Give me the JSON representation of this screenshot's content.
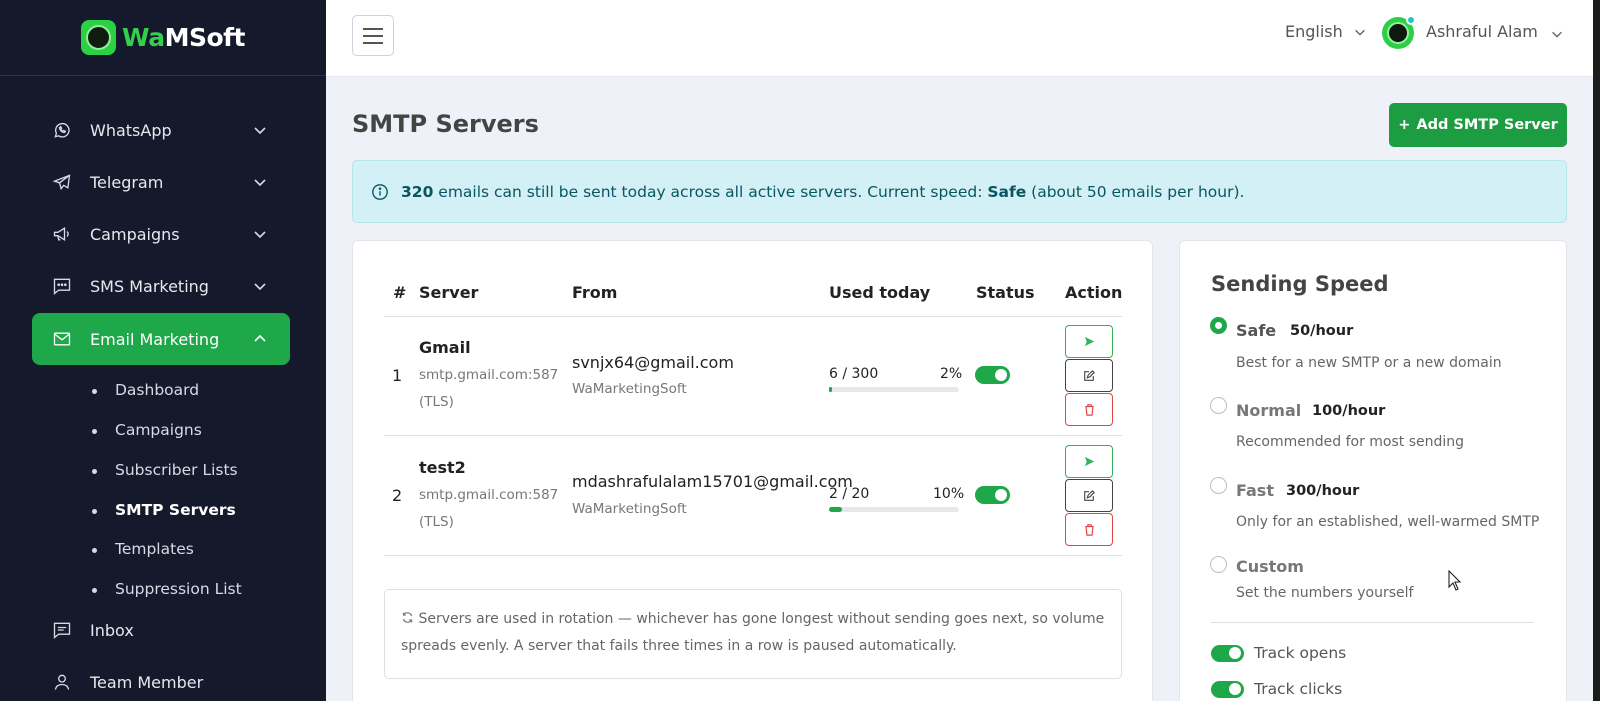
{
  "brand": {
    "name_part1": "Wa",
    "name_part2": "MSoft"
  },
  "sidebar": {
    "items": [
      {
        "label": "WhatsApp"
      },
      {
        "label": "Telegram"
      },
      {
        "label": "Campaigns"
      },
      {
        "label": "SMS Marketing"
      },
      {
        "label": "Email Marketing"
      },
      {
        "label": "Inbox"
      },
      {
        "label": "Team Member"
      }
    ],
    "email_sub": [
      "Dashboard",
      "Campaigns",
      "Subscriber Lists",
      "SMTP Servers",
      "Templates",
      "Suppression List"
    ]
  },
  "topbar": {
    "language": "English",
    "user_name": "Ashraful Alam"
  },
  "page": {
    "title": "SMTP Servers",
    "add_button": "Add SMTP Server"
  },
  "alert": {
    "count": "320",
    "text1": " emails can still be sent today across all active servers. Current speed: ",
    "speed": "Safe",
    "text2": " (about 50 emails per hour)."
  },
  "table": {
    "headers": [
      "#",
      "Server",
      "From",
      "Used today",
      "Status",
      "Action"
    ],
    "rows": [
      {
        "num": "1",
        "name": "Gmail",
        "host": "smtp.gmail.com:587",
        "security": "(TLS)",
        "from_email": "svnjx64@gmail.com",
        "from_name": "WaMarketingSoft",
        "usage": "6 / 300",
        "pct": "2%",
        "pct_value": 0.02,
        "enabled": true
      },
      {
        "num": "2",
        "name": "test2",
        "host": "smtp.gmail.com:587",
        "security": "(TLS)",
        "from_email": "mdashrafulalam15701@gmail.com",
        "from_name": "WaMarketingSoft",
        "usage": "2 / 20",
        "pct": "10%",
        "pct_value": 0.1,
        "enabled": true
      }
    ]
  },
  "note": "Servers are used in rotation — whichever has gone longest without sending goes next, so volume spreads evenly. A server that fails three times in a row is paused automatically.",
  "speed": {
    "title": "Sending Speed",
    "options": [
      {
        "name": "Safe",
        "rate": "50/hour",
        "desc": "Best for a new SMTP or a new domain",
        "selected": true
      },
      {
        "name": "Normal",
        "rate": "100/hour",
        "desc": "Recommended for most sending",
        "selected": false
      },
      {
        "name": "Fast",
        "rate": "300/hour",
        "desc": "Only for an established, well-warmed SMTP",
        "selected": false
      },
      {
        "name": "Custom",
        "rate": "",
        "desc": "Set the numbers yourself",
        "selected": false
      }
    ],
    "track_opens": "Track opens",
    "track_clicks": "Track clicks"
  },
  "colors": {
    "accent": "#1fa84a",
    "sidebar_bg": "#141a2b",
    "alert_bg": "#d2f0f5",
    "danger": "#e04646"
  }
}
